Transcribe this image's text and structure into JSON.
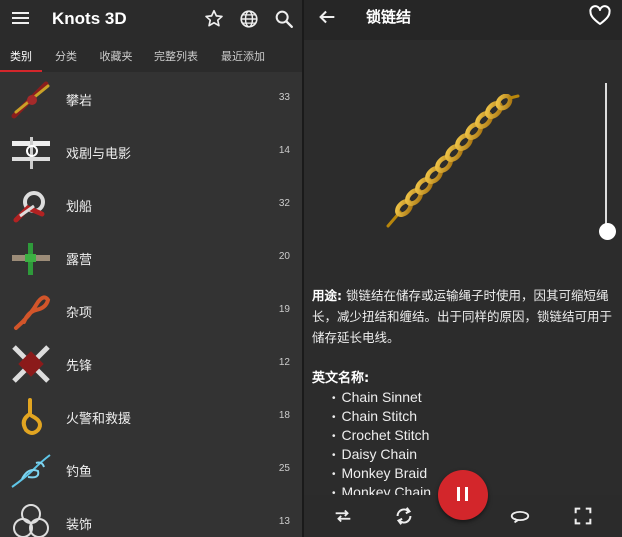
{
  "app": {
    "title": "Knots 3D"
  },
  "tabs": [
    {
      "label": "类别",
      "active": true
    },
    {
      "label": "分类",
      "active": false
    },
    {
      "label": "收藏夹",
      "active": false
    },
    {
      "label": "完整列表",
      "active": false
    },
    {
      "label": "最近添加",
      "active": false
    }
  ],
  "categories": [
    {
      "label": "攀岩",
      "count": "33"
    },
    {
      "label": "戏剧与电影",
      "count": "14"
    },
    {
      "label": "划船",
      "count": "32"
    },
    {
      "label": "露营",
      "count": "20"
    },
    {
      "label": "杂项",
      "count": "19"
    },
    {
      "label": "先锋",
      "count": "12"
    },
    {
      "label": "火警和救援",
      "count": "18"
    },
    {
      "label": "钓鱼",
      "count": "25"
    },
    {
      "label": "装饰",
      "count": "13"
    }
  ],
  "knot": {
    "title": "锁链结",
    "usage_label": "用途:",
    "usage_text": "锁链结在储存或运输绳子时使用，因其可缩短绳长，减少扭结和缠结。出于同样的原因，锁链结可用于储存延长电线。",
    "alt_names_label": "英文名称:",
    "alt_names": [
      "Chain Sinnet",
      "Chain Stitch",
      "Crochet Stitch",
      "Daisy Chain",
      "Monkey Braid",
      "Monkey Chain"
    ]
  },
  "player": {
    "speed_slider_value": 0.05
  },
  "colors": {
    "accent": "#d3262b",
    "rope_gold": "#d9a21c"
  }
}
